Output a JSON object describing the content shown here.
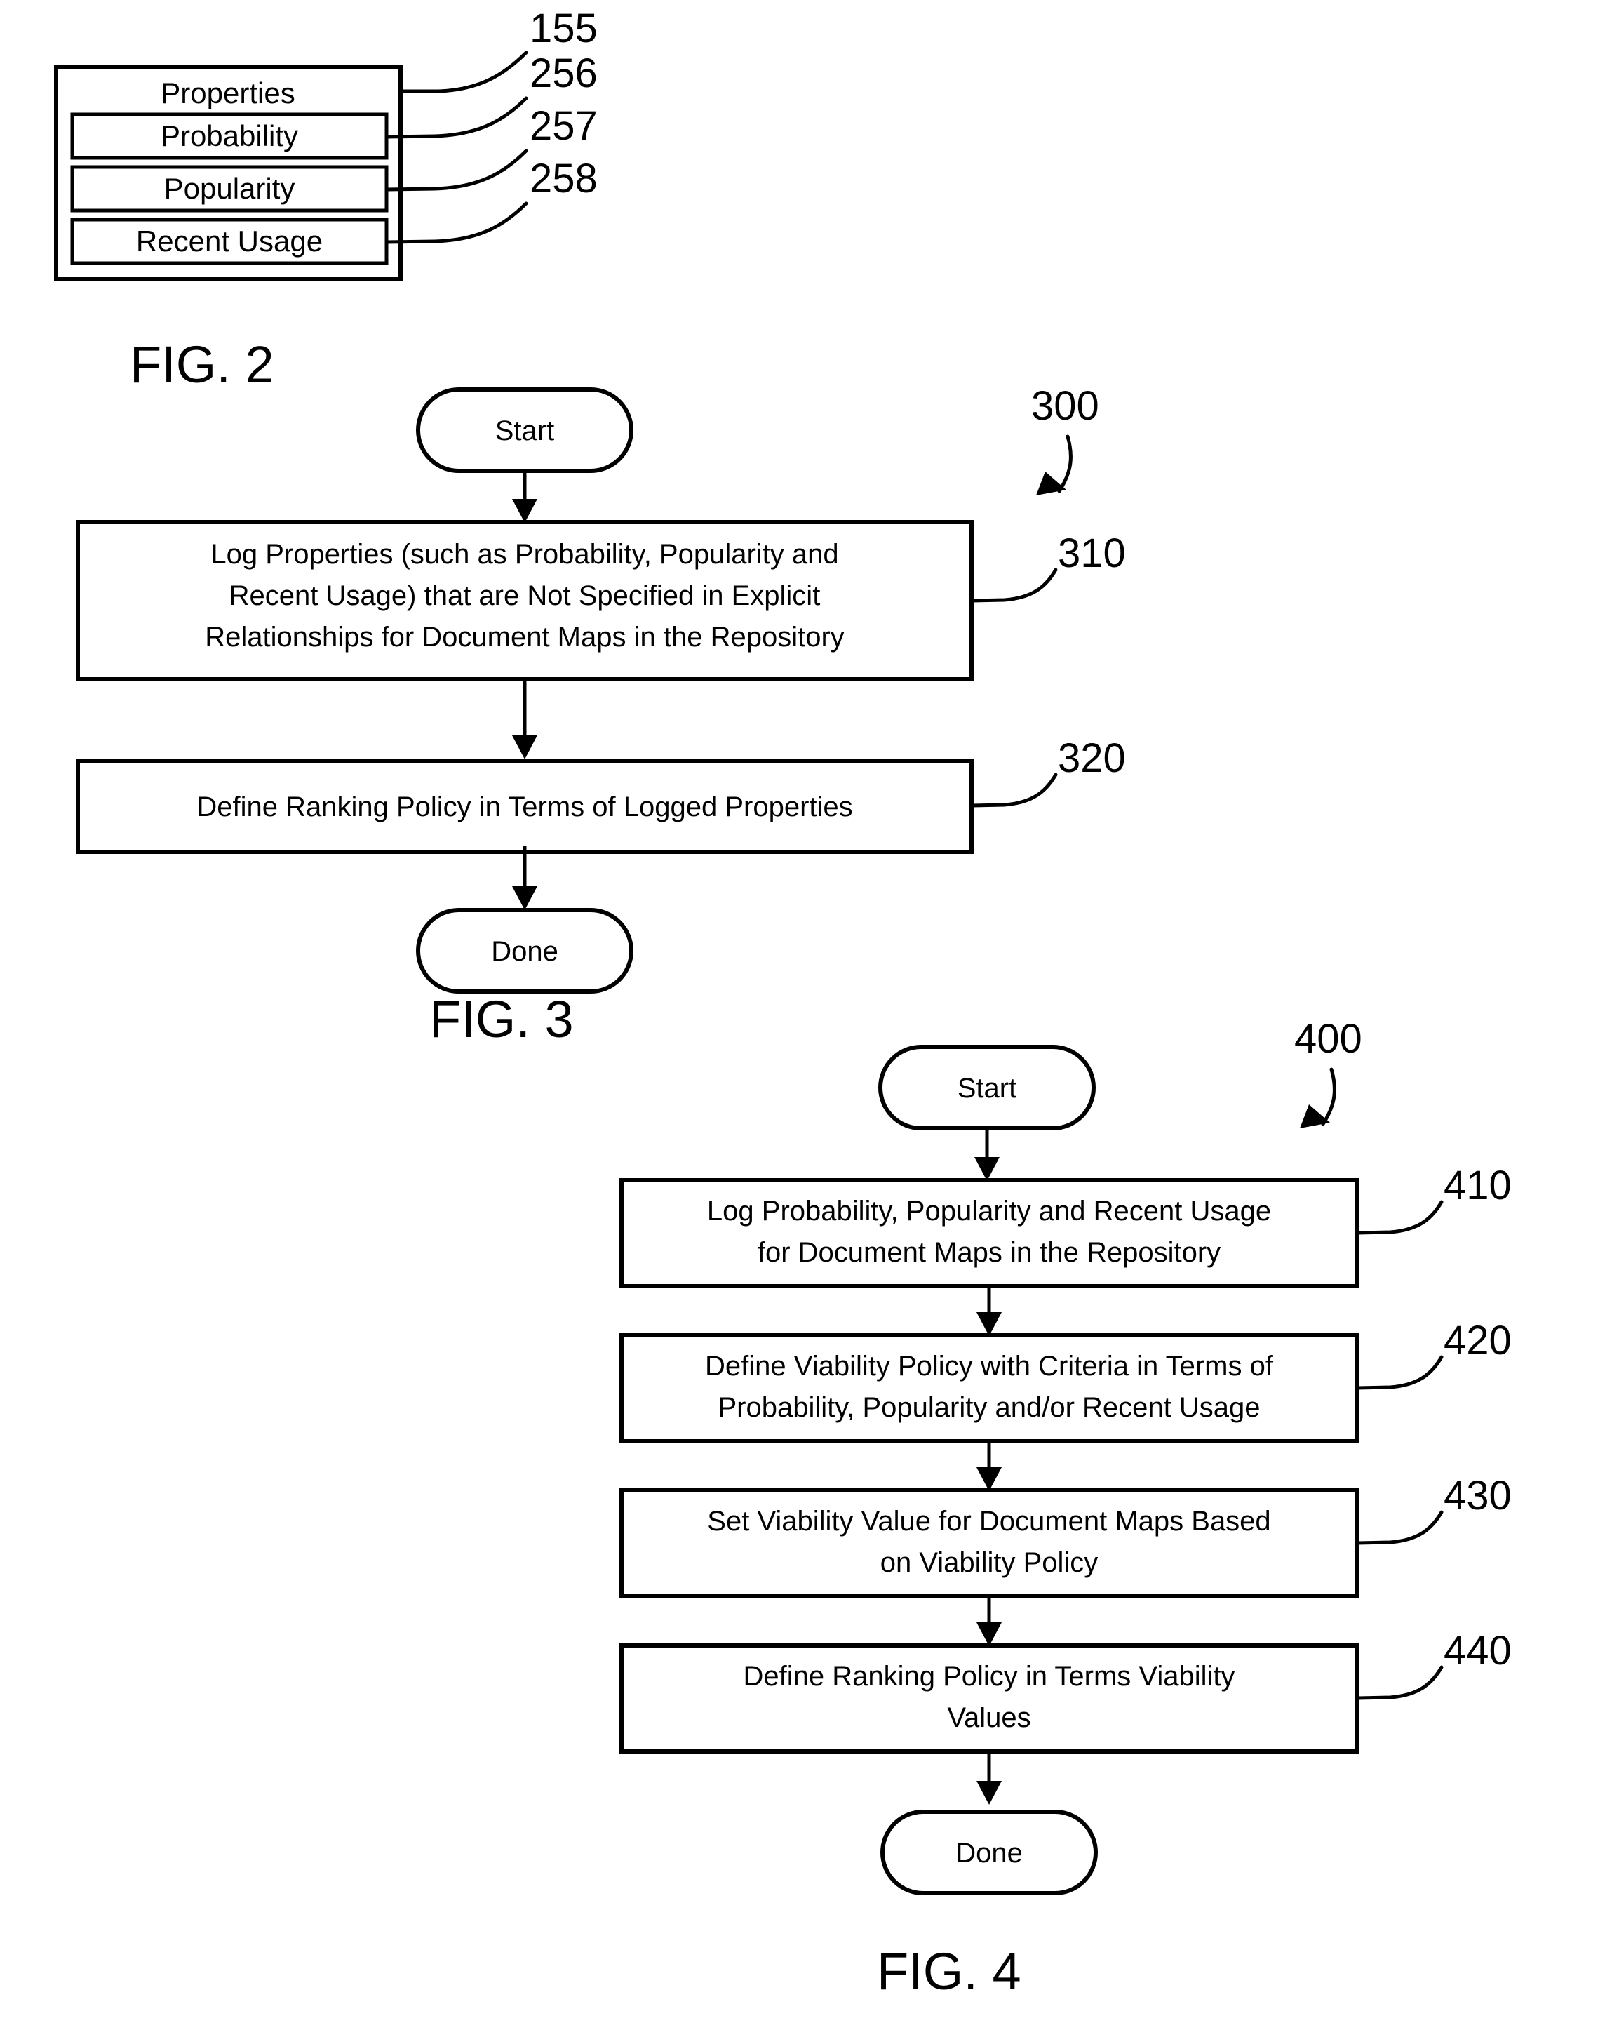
{
  "sheet": {
    "background": "#ffffff",
    "ink": "#000000"
  },
  "figures": [
    {
      "id": "fig2",
      "title": "FIG. 2",
      "kind": "block-diagram",
      "outer_box": {
        "label": "Properties",
        "ref": "155"
      },
      "inner_boxes": [
        {
          "label": "Probability",
          "ref": "256"
        },
        {
          "label": "Popularity",
          "ref": "257"
        },
        {
          "label": "Recent Usage",
          "ref": "258"
        }
      ]
    },
    {
      "id": "fig3",
      "title": "FIG. 3",
      "kind": "flowchart",
      "ref": "300",
      "start_label": "Start",
      "done_label": "Done",
      "steps": [
        {
          "ref": "310",
          "lines": [
            "Log Properties (such as Probability, Popularity and",
            "Recent Usage) that are Not Specified in Explicit",
            "Relationships for Document Maps in the Repository"
          ]
        },
        {
          "ref": "320",
          "lines": [
            "Define Ranking Policy in Terms of Logged Properties"
          ]
        }
      ]
    },
    {
      "id": "fig4",
      "title": "FIG. 4",
      "kind": "flowchart",
      "ref": "400",
      "start_label": "Start",
      "done_label": "Done",
      "steps": [
        {
          "ref": "410",
          "lines": [
            "Log Probability, Popularity and Recent Usage",
            "for Document Maps in the Repository"
          ]
        },
        {
          "ref": "420",
          "lines": [
            "Define Viability Policy with Criteria in Terms of",
            "Probability, Popularity and/or Recent Usage"
          ]
        },
        {
          "ref": "430",
          "lines": [
            "Set Viability Value for Document Maps Based",
            "on Viability Policy"
          ]
        },
        {
          "ref": "440",
          "lines": [
            "Define Ranking Policy in Terms Viability",
            "Values"
          ]
        }
      ]
    }
  ]
}
